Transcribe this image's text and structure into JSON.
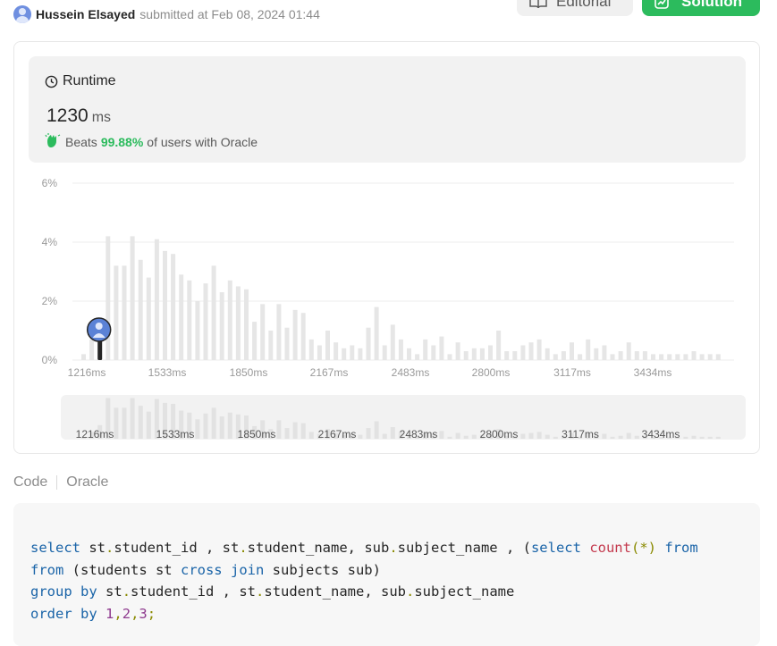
{
  "submission": {
    "author": "Hussein Elsayed",
    "meta": "submitted at Feb 08, 2024 01:44"
  },
  "buttons": {
    "editorial": "Editorial",
    "solution": "Solution"
  },
  "runtime": {
    "title": "Runtime",
    "value": "1230",
    "unit": "ms",
    "beats_prefix": "Beats",
    "beats_pct": "99.88%",
    "beats_suffix": "of users with Oracle"
  },
  "colors": {
    "accent_green": "#2cbb5d",
    "bar": "#e6e6e6",
    "grid": "#ececec"
  },
  "chart_data": {
    "type": "bar",
    "ylim": [
      0,
      6
    ],
    "yticks": [
      "6%",
      "4%",
      "2%",
      "0%"
    ],
    "ytick_values": [
      6,
      4,
      2,
      0
    ],
    "xticks": [
      "1216ms",
      "1533ms",
      "1850ms",
      "2167ms",
      "2483ms",
      "2800ms",
      "3117ms",
      "3434ms"
    ],
    "user_bin_index": 2,
    "values": [
      0.2,
      0.7,
      1.4,
      4.2,
      3.2,
      3.2,
      4.2,
      3.4,
      2.8,
      4.1,
      3.7,
      3.6,
      2.9,
      2.7,
      2.0,
      2.6,
      3.2,
      2.3,
      2.7,
      2.5,
      2.4,
      1.3,
      1.9,
      1.0,
      1.9,
      1.1,
      1.7,
      1.6,
      0.7,
      0.5,
      1.0,
      0.6,
      0.4,
      0.5,
      0.4,
      1.1,
      1.8,
      0.5,
      1.2,
      0.7,
      0.4,
      0.2,
      0.7,
      0.5,
      0.8,
      0.2,
      0.6,
      0.3,
      0.4,
      0.4,
      0.5,
      1.0,
      0.3,
      0.3,
      0.5,
      0.6,
      0.7,
      0.4,
      0.2,
      0.3,
      0.6,
      0.2,
      0.7,
      0.4,
      0.5,
      0.2,
      0.3,
      0.6,
      0.3,
      0.3,
      0.2,
      0.2,
      0.2,
      0.2,
      0.2,
      0.3,
      0.2,
      0.2,
      0.2
    ]
  },
  "code": {
    "label": "Code",
    "language": "Oracle",
    "lines": [
      [
        [
          "kw",
          "select"
        ],
        [
          "t",
          " st"
        ],
        [
          "op",
          "."
        ],
        [
          "t",
          "student_id , st"
        ],
        [
          "op",
          "."
        ],
        [
          "t",
          "student_name, sub"
        ],
        [
          "op",
          "."
        ],
        [
          "t",
          "subject_name , ("
        ],
        [
          "kw",
          "select"
        ],
        [
          "t",
          " "
        ],
        [
          "fn",
          "count"
        ],
        [
          "op",
          "(*)"
        ],
        [
          "t",
          " "
        ],
        [
          "kw",
          "from"
        ],
        [
          "t",
          " "
        ]
      ],
      [
        [
          "kw",
          "from"
        ],
        [
          "t",
          " (students st "
        ],
        [
          "kw",
          "cross"
        ],
        [
          "t",
          " "
        ],
        [
          "kw",
          "join"
        ],
        [
          "t",
          " subjects sub)"
        ]
      ],
      [
        [
          "kw",
          "group"
        ],
        [
          "t",
          " "
        ],
        [
          "kw",
          "by"
        ],
        [
          "t",
          " st"
        ],
        [
          "op",
          "."
        ],
        [
          "t",
          "student_id , st"
        ],
        [
          "op",
          "."
        ],
        [
          "t",
          "student_name, sub"
        ],
        [
          "op",
          "."
        ],
        [
          "t",
          "subject_name"
        ]
      ],
      [
        [
          "kw",
          "order"
        ],
        [
          "t",
          " "
        ],
        [
          "kw",
          "by"
        ],
        [
          "t",
          " "
        ],
        [
          "num",
          "1"
        ],
        [
          "op",
          ","
        ],
        [
          "num",
          "2"
        ],
        [
          "op",
          ","
        ],
        [
          "num",
          "3"
        ],
        [
          "op",
          ";"
        ]
      ]
    ]
  }
}
